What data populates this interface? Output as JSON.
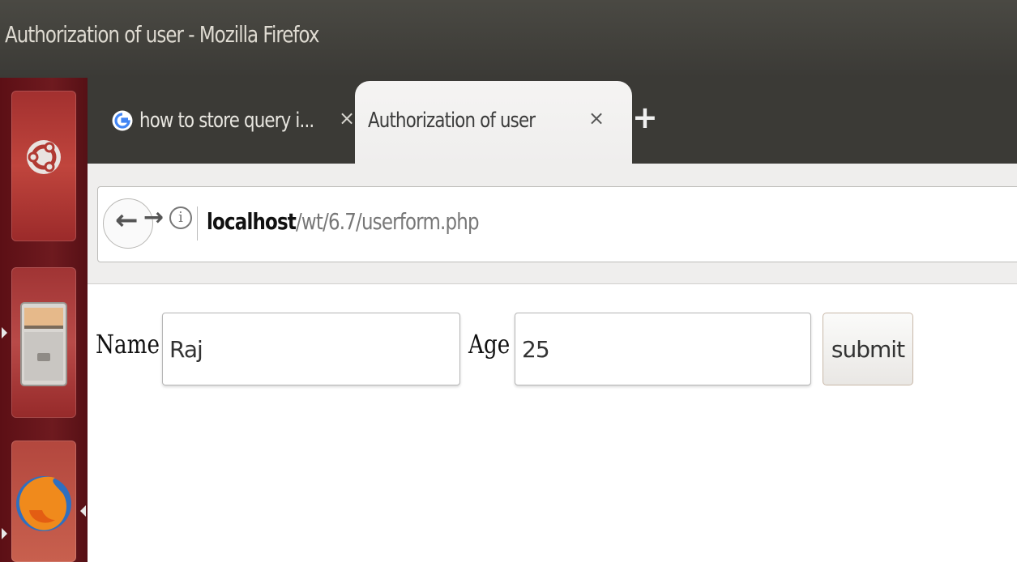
{
  "window": {
    "title": "Authorization of user - Mozilla Firefox"
  },
  "tabs": [
    {
      "label": "how to store query i...",
      "close": "×",
      "icon": "google-icon",
      "active": false
    },
    {
      "label": "Authorization of user",
      "close": "×",
      "active": true
    }
  ],
  "new_tab": "+",
  "navbar": {
    "back": "←",
    "forward": "→",
    "info": "i",
    "url_host": "localhost",
    "url_path": "/wt/6.7/userform.php"
  },
  "form": {
    "name_label": "Name",
    "name_value": "Raj",
    "age_label": "Age",
    "age_value": "25",
    "submit_label": "submit"
  },
  "launcher": [
    "ubuntu-logo-icon",
    "files-icon",
    "firefox-icon"
  ],
  "colors": {
    "launcher": "#6e1a1f",
    "titlebar": "#3b3a36",
    "active_tab": "#f5f4f3"
  }
}
